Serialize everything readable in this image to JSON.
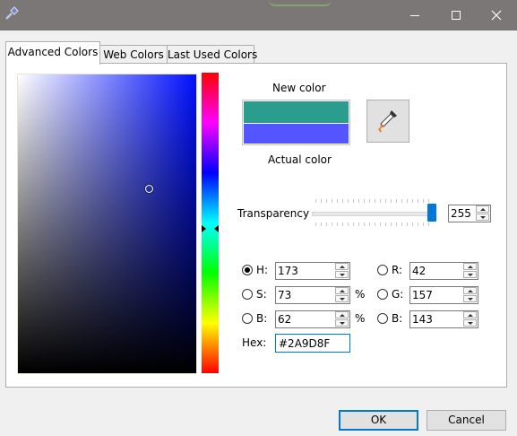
{
  "window": {
    "close_glyph": "✕"
  },
  "tabs": [
    {
      "label": "Advanced Colors",
      "active": true
    },
    {
      "label": "Web Colors",
      "active": false
    },
    {
      "label": "Last Used Colors",
      "active": false
    }
  ],
  "preview": {
    "new_label": "New color",
    "actual_label": "Actual color",
    "new_color": "#2A9D8F",
    "actual_color": "#5555FF"
  },
  "transparency": {
    "label": "Transparency",
    "value": "255",
    "level": 1.0
  },
  "hsb": {
    "h_label": "H:",
    "h_value": "173",
    "s_label": "S:",
    "s_value": "73",
    "b_label": "B:",
    "b_value": "62",
    "percent": "%",
    "selected": "H"
  },
  "rgb": {
    "r_label": "R:",
    "r_value": "42",
    "g_label": "G:",
    "g_value": "157",
    "b_label": "B:",
    "b_value": "143"
  },
  "hex": {
    "label": "Hex:",
    "value": "#2A9D8F"
  },
  "buttons": {
    "ok": "OK",
    "cancel": "Cancel"
  },
  "icons": {
    "app": "color-picker-app-icon",
    "eyedropper": "eyedropper-icon",
    "maximize": "maximize-icon",
    "minimize": "minimize-icon",
    "close": "close-icon"
  }
}
